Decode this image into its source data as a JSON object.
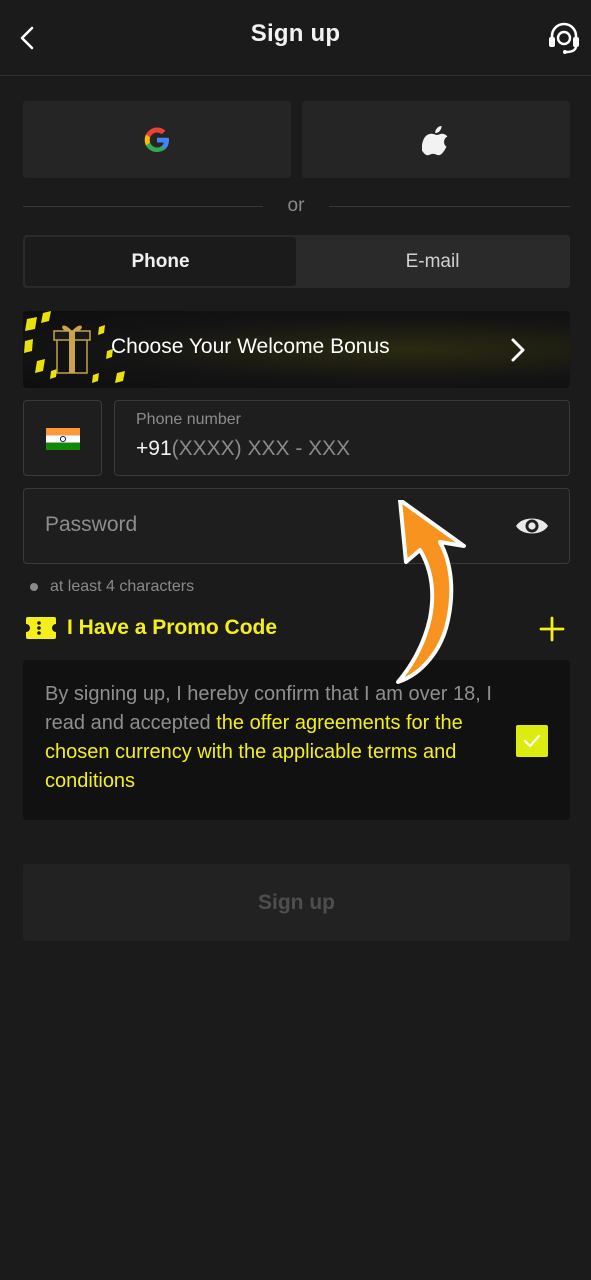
{
  "header": {
    "title": "Sign up"
  },
  "social": {
    "icons": [
      "google-icon",
      "apple-icon"
    ]
  },
  "divider": {
    "text": "or"
  },
  "tabs": [
    {
      "label": "Phone",
      "active": true
    },
    {
      "label": "E-mail",
      "active": false
    }
  ],
  "bonus": {
    "label": "Choose Your Welcome Bonus"
  },
  "phone": {
    "label": "Phone number",
    "prefix": "+91",
    "placeholder": "(XXXX) XXX - XXX",
    "country_flag": "india-flag-icon"
  },
  "password": {
    "placeholder": "Password",
    "hint": "at least 4 characters"
  },
  "promo": {
    "label": "I Have a Promo Code"
  },
  "terms": {
    "text_plain": "By signing up, I hereby confirm that I am over 18, I read and accepted ",
    "text_link": "the offer agreements for the chosen currency with the applicable terms and conditions",
    "checked": true
  },
  "submit": {
    "label": "Sign up"
  },
  "colors": {
    "accent": "#f4ef1c",
    "background": "#1b1b1b",
    "annotation_arrow": "#f7931e"
  }
}
